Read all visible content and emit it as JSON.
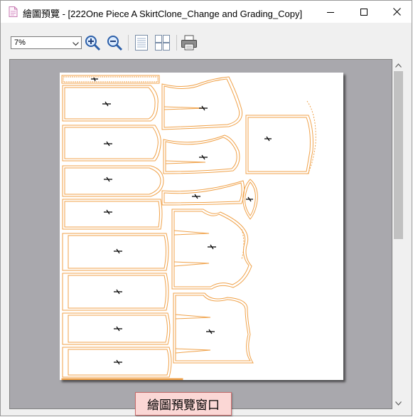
{
  "window": {
    "title": "繪圖預覽 - [222One Piece A SkirtClone_Change and Grading_Copy]",
    "title_icon": "document-preview-icon",
    "controls": [
      "minimize-icon",
      "maximize-icon",
      "close-icon"
    ]
  },
  "toolbar": {
    "zoom_value": "7%",
    "buttons": [
      {
        "name": "zoom-in-button",
        "icon": "zoom-in-icon"
      },
      {
        "name": "zoom-out-button",
        "icon": "zoom-out-icon"
      },
      {
        "name": "single-page-button",
        "icon": "single-page-icon"
      },
      {
        "name": "multi-page-button",
        "icon": "multi-page-icon"
      },
      {
        "name": "print-button",
        "icon": "printer-icon"
      }
    ]
  },
  "preview": {
    "content": "pattern marker layout",
    "outline_color": "#f0a24a",
    "background_color": "#a9a8ad"
  },
  "tooltip": {
    "text": "繪圖預覽窗口"
  }
}
